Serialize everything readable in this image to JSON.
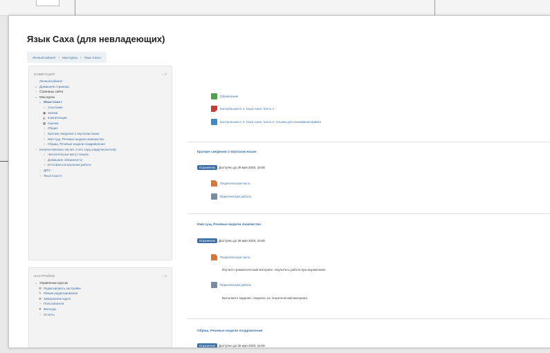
{
  "page": {
    "title": "Язык Саха (для невладеющих)"
  },
  "breadcrumb": [
    "Личный кабинет",
    "Мои курсы",
    "Язык Саха I"
  ],
  "navigation": {
    "heading": "НАВИГАЦИЯ",
    "control": "− □",
    "items": [
      {
        "label": "Личный кабинет",
        "level": 1,
        "mark": "",
        "style": "link"
      },
      {
        "label": "Домашняя страница",
        "level": 1,
        "mark": "⌂",
        "style": "link"
      },
      {
        "label": "Страницы сайта",
        "level": 1,
        "mark": "›",
        "style": "dark"
      },
      {
        "label": "Мои курсы",
        "level": 1,
        "mark": "⌄",
        "style": "dark"
      },
      {
        "label": "Язык Саха I",
        "level": 2,
        "mark": "⌄",
        "style": "bold"
      },
      {
        "label": "Участники",
        "level": 3,
        "mark": "›",
        "style": "link"
      },
      {
        "label": "Значки",
        "level": 3,
        "mark": "▣",
        "style": "link"
      },
      {
        "label": "Компетенции",
        "level": 3,
        "mark": "◭",
        "style": "link"
      },
      {
        "label": "Оценки",
        "level": 3,
        "mark": "▦",
        "style": "link"
      },
      {
        "label": "Общее",
        "level": 3,
        "mark": "›",
        "style": "link"
      },
      {
        "label": "Краткие сведения о якутском языке",
        "level": 3,
        "mark": "›",
        "style": "link"
      },
      {
        "label": "Имя сущ. Речевые модели знакомства",
        "level": 3,
        "mark": "›",
        "style": "link"
      },
      {
        "label": "Обращ. Речевые модели поздравления",
        "level": 3,
        "mark": "›",
        "style": "link"
      },
      {
        "label": "Количественные числит. Счет, седы ряда(числители)",
        "level": 3,
        "mark": "›",
        "style": "wrap"
      },
      {
        "label": "Числительные могут помочь",
        "level": 3,
        "mark": "›",
        "style": "link"
      },
      {
        "label": "Домашние обязанности",
        "level": 3,
        "mark": "›",
        "style": "link"
      },
      {
        "label": "Итоговая контрольная работа",
        "level": 3,
        "mark": "›",
        "style": "link"
      },
      {
        "label": "ДПО",
        "level": 2,
        "mark": "›",
        "style": "link"
      },
      {
        "label": "Язык Саха II",
        "level": 2,
        "mark": "›",
        "style": "link"
      }
    ]
  },
  "settings": {
    "heading": "НАСТРОЙКИ",
    "control": "− □",
    "items": [
      {
        "label": "Управление курсом",
        "level": 1,
        "mark": "⌄",
        "style": "dark"
      },
      {
        "label": "Редактировать настройки",
        "level": 2,
        "mark": "⚙",
        "style": "link"
      },
      {
        "label": "Режим редактирования",
        "level": 2,
        "mark": "✎",
        "style": "link"
      },
      {
        "label": "Завершение курса",
        "level": 2,
        "mark": "⚙",
        "style": "link"
      },
      {
        "label": "Пользователи",
        "level": 2,
        "mark": "›",
        "style": "link"
      },
      {
        "label": "Фильтры",
        "level": 2,
        "mark": "▼",
        "style": "link"
      },
      {
        "label": "Отчеты",
        "level": 2,
        "mark": "›",
        "style": "link"
      }
    ]
  },
  "main": {
    "top_activities": [
      {
        "icon": "forum-icon",
        "label": "Объявления"
      },
      {
        "icon": "quiz-icon",
        "label": "Контрольная С 1. Саха тыла. Часть 1"
      },
      {
        "icon": "assignment-icon",
        "label": "Контрольная С 2. Саха тыла. Часть 2. Ссылка для скачивания файла"
      }
    ],
    "sections": [
      {
        "title": "Краткие сведения о якутском языке",
        "restriction_badge": "Ограничено",
        "restriction_text": "Доступно до 28 мая 2020, 15:00",
        "activities": [
          {
            "icon": "page-icon",
            "label": "Теоретическая часть",
            "desc": ""
          },
          {
            "icon": "work-icon",
            "label": "Практическая работа",
            "desc": ""
          }
        ]
      },
      {
        "title": "Имя сущ. Речевые модели знакомства",
        "restriction_badge": "Ограничено",
        "restriction_text": "Доступно до 28 мая 2020, 15:00",
        "activities": [
          {
            "icon": "page-icon",
            "label": "Теоретическая часть",
            "desc": "Изучите грамматический материал. Научитесь работе при выражениях."
          },
          {
            "icon": "work-icon",
            "label": "Практическая работа",
            "desc": "Выполните задания, опираясь на теоретический материал."
          }
        ]
      },
      {
        "title": "Обращ. Речевые модели поздравления",
        "restriction_badge": "Ограничено",
        "restriction_text": "Доступно до 28 мая 2020, 15:00",
        "activities": []
      }
    ]
  }
}
